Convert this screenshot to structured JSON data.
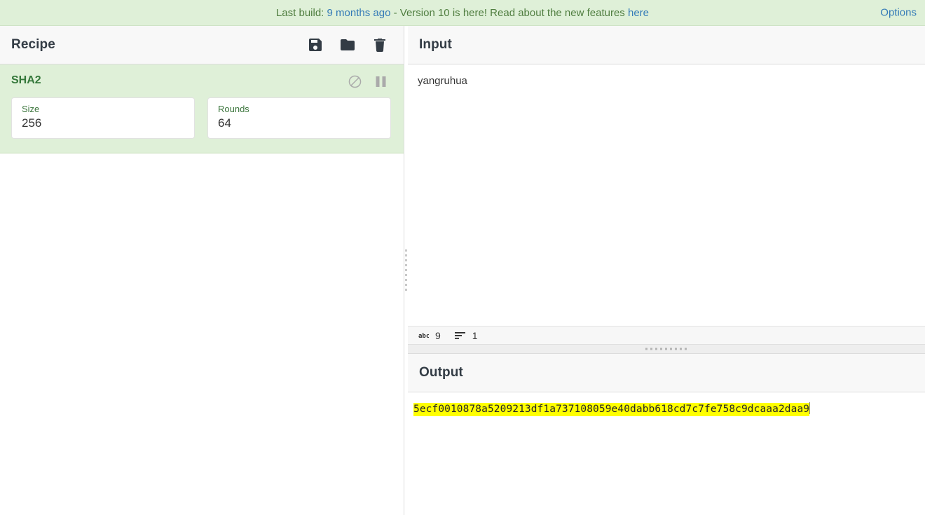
{
  "banner": {
    "build_prefix": "Last build: ",
    "build_age_link": "9 months ago",
    "separator": " - ",
    "version_text": "Version 10 is here! Read about the new features ",
    "features_link": "here",
    "options_label": "Options",
    "link_color": "#337ab7",
    "text_color": "#4f7d3f",
    "background": "#dff0d8"
  },
  "recipe": {
    "title": "Recipe",
    "icons": [
      {
        "name": "save-icon",
        "title": "Save recipe"
      },
      {
        "name": "folder-icon",
        "title": "Load recipe"
      },
      {
        "name": "trash-icon",
        "title": "Clear recipe"
      }
    ],
    "operations": [
      {
        "name": "SHA2",
        "title_color": "#34773a",
        "background": "#dff0d8",
        "icons": [
          {
            "name": "disable-icon",
            "title": "Disable operation"
          },
          {
            "name": "breakpoint-icon",
            "title": "Set breakpoint"
          }
        ],
        "args": [
          {
            "label": "Size",
            "value": "256"
          },
          {
            "label": "Rounds",
            "value": "64"
          }
        ]
      }
    ]
  },
  "input": {
    "title": "Input",
    "value": "yangruhua",
    "status": {
      "length_icon": "abc-icon",
      "length": "9",
      "lines_icon": "lines-icon",
      "lines": "1"
    }
  },
  "output": {
    "title": "Output",
    "value": "5ecf0010878a5209213df1a737108059e40dabb618cd7c7fe758c9dcaaa2daa9",
    "highlight_color": "#ffff00"
  }
}
